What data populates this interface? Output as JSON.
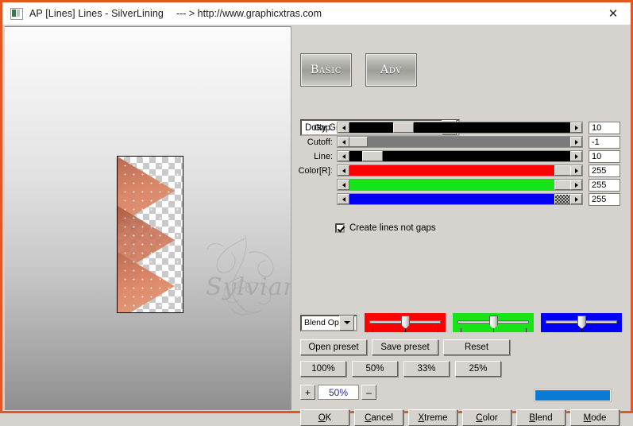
{
  "window": {
    "title_app": "AP [Lines]  Lines - SilverLining",
    "title_url": "--- > http://www.graphicxtras.com",
    "close_label": "✕",
    "icon": "app-icon",
    "border_color": "#e25822"
  },
  "preview": {
    "watermark_text": "Sylviane",
    "image_alt": "lines-silverlining-preview"
  },
  "mode_buttons": [
    {
      "label": "Basic",
      "name": "basic"
    },
    {
      "label": "Adv",
      "name": "adv"
    }
  ],
  "preset": {
    "selected": "Dotty Grid",
    "arrow": "chevron-down-icon"
  },
  "sliders": [
    {
      "label": "Gap:",
      "value": "10",
      "thumb_pct": 22,
      "fill": "#000000",
      "track": "#000000"
    },
    {
      "label": "Cutoff:",
      "value": "-1",
      "thumb_pct": 1,
      "fill": "#7b7b7b",
      "track": "#7b7b7b"
    },
    {
      "label": "Line:",
      "value": "10",
      "thumb_pct": 8,
      "fill": "#000000",
      "track": "#000000"
    },
    {
      "label": "Color[R]:",
      "value": "255",
      "thumb_pct": 95,
      "fill": "#fe0000",
      "track": "#fe0000"
    },
    {
      "label": "",
      "value": "255",
      "thumb_pct": 95,
      "fill": "#16e416",
      "track": "#16e416"
    },
    {
      "label": "",
      "value": "255",
      "thumb_pct": 95,
      "fill": "#0000f4",
      "track": "#0000f4",
      "dither": true
    }
  ],
  "checkbox": {
    "label": "Create lines not gaps",
    "checked": true
  },
  "blend": {
    "combo_label": "Blend Opti",
    "arrow": "chevron-down-icon",
    "channels": [
      {
        "name": "red",
        "color": "#fe0000",
        "thumb_pct": 50
      },
      {
        "name": "green",
        "color": "#16e416",
        "thumb_pct": 50
      },
      {
        "name": "blue",
        "color": "#0000f4",
        "thumb_pct": 50
      }
    ]
  },
  "preset_buttons": [
    {
      "label": "Open preset",
      "name": "open-preset"
    },
    {
      "label": "Save preset",
      "name": "save-preset"
    },
    {
      "label": "Reset",
      "name": "reset"
    }
  ],
  "zoom_buttons": [
    {
      "label": "100%"
    },
    {
      "label": "50%"
    },
    {
      "label": "33%"
    },
    {
      "label": "25%"
    }
  ],
  "zoom_stepper": {
    "plus": "+",
    "minus": "–",
    "value": "50%"
  },
  "color_swatch": {
    "color": "#0a7ad4"
  },
  "action_buttons": [
    {
      "accel": "O",
      "rest": "K",
      "name": "ok"
    },
    {
      "accel": "C",
      "rest": "ancel",
      "name": "cancel"
    },
    {
      "accel": "X",
      "rest": "treme",
      "name": "xtreme"
    },
    {
      "accel": "C",
      "rest": "olor",
      "name": "color"
    },
    {
      "accel": "B",
      "rest": "lend",
      "name": "blend"
    },
    {
      "accel": "M",
      "rest": "ode",
      "name": "mode"
    }
  ]
}
